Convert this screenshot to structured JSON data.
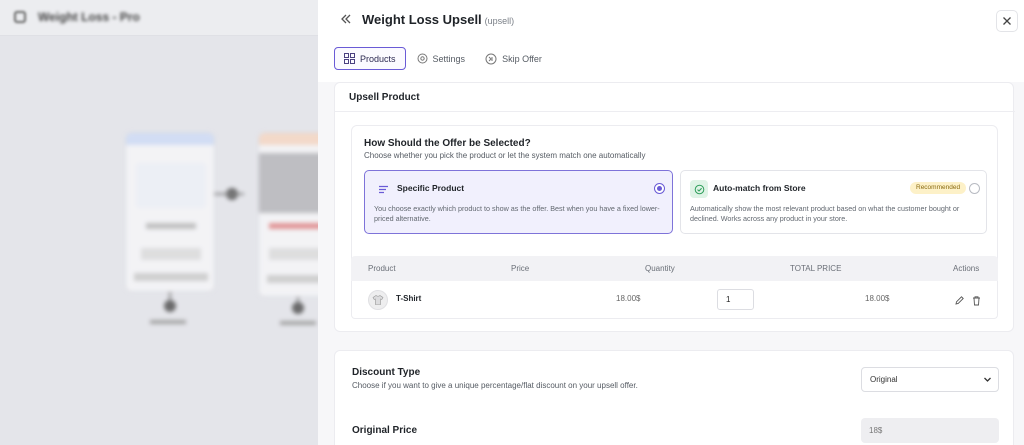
{
  "background": {
    "title": "Weight Loss - Pro"
  },
  "panel": {
    "title": "Weight Loss Upsell",
    "tag": "(upsell)"
  },
  "tabs": [
    {
      "label": "Products",
      "icon": "grid-icon",
      "active": true
    },
    {
      "label": "Settings",
      "icon": "gear-icon",
      "active": false
    },
    {
      "label": "Skip Offer",
      "icon": "skip-icon",
      "active": false
    }
  ],
  "upsell_product": {
    "title": "Upsell Product",
    "selection": {
      "title": "How Should the Offer be Selected?",
      "subtitle": "Choose whether you pick the product or let the system match one automatically",
      "options": [
        {
          "title": "Specific Product",
          "description": "You choose exactly which product to show as the offer. Best when you have a fixed lower-priced alternative.",
          "selected": true,
          "icon": "list-icon"
        },
        {
          "title": "Auto-match from Store",
          "badge": "Recommended",
          "description": "Automatically show the most relevant product based on what the customer bought or declined. Works across any product in your store.",
          "selected": false,
          "icon": "check-circle-icon"
        }
      ]
    },
    "table": {
      "columns": [
        "Product",
        "Price",
        "Quantity",
        "TOTAL PRICE",
        "Actions"
      ],
      "rows": [
        {
          "product": "T-Shirt",
          "price": "18.00$",
          "quantity": "1",
          "total": "18.00$"
        }
      ]
    }
  },
  "discount": {
    "label": "Discount Type",
    "subtitle": "Choose if you want to give a unique percentage/flat discount on your upsell offer.",
    "value": "Original"
  },
  "original_price": {
    "label": "Original Price",
    "value": "18$"
  },
  "colors": {
    "accent": "#6a5bd6",
    "badge_bg": "#fdf1c8",
    "selected_bg": "#f1f0fd"
  }
}
